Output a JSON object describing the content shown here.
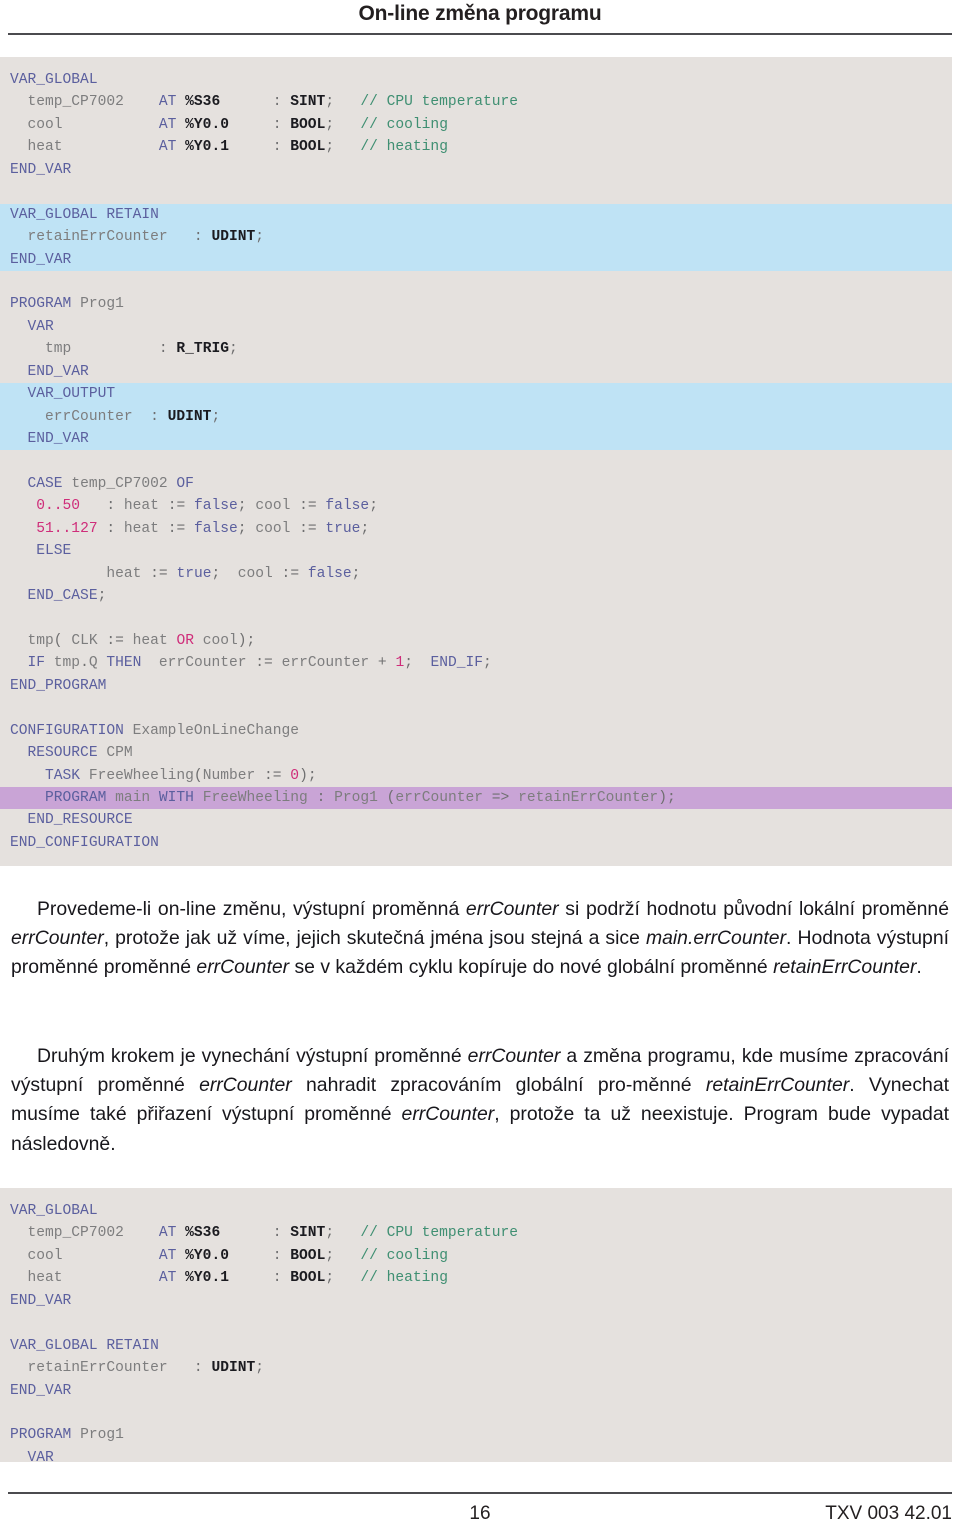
{
  "header": {
    "title": "On-line změna programu"
  },
  "code_block_1": {
    "language": "IEC 61131-3 Structured Text",
    "lines": [
      {
        "highlight": "none",
        "text": "VAR_GLOBAL"
      },
      {
        "highlight": "none",
        "text": "  temp_CP7002    AT %S36      : SINT;   // CPU temperature"
      },
      {
        "highlight": "none",
        "text": "  cool           AT %Y0.0     : BOOL;   // cooling"
      },
      {
        "highlight": "none",
        "text": "  heat           AT %Y0.1     : BOOL;   // heating"
      },
      {
        "highlight": "none",
        "text": "END_VAR"
      },
      {
        "highlight": "none",
        "text": ""
      },
      {
        "highlight": "blue",
        "text": "VAR_GLOBAL RETAIN"
      },
      {
        "highlight": "blue",
        "text": "  retainErrCounter   : UDINT;"
      },
      {
        "highlight": "blue",
        "text": "END_VAR"
      },
      {
        "highlight": "none",
        "text": ""
      },
      {
        "highlight": "none",
        "text": "PROGRAM Prog1"
      },
      {
        "highlight": "none",
        "text": "  VAR"
      },
      {
        "highlight": "none",
        "text": "    tmp          : R_TRIG;"
      },
      {
        "highlight": "none",
        "text": "  END_VAR"
      },
      {
        "highlight": "blue",
        "text": "  VAR_OUTPUT"
      },
      {
        "highlight": "blue",
        "text": "    errCounter  : UDINT;"
      },
      {
        "highlight": "blue",
        "text": "  END_VAR"
      },
      {
        "highlight": "none",
        "text": ""
      },
      {
        "highlight": "none",
        "text": "  CASE temp_CP7002 OF"
      },
      {
        "highlight": "none",
        "text": "   0..50   : heat := false; cool := false;"
      },
      {
        "highlight": "none",
        "text": "   51..127 : heat := false; cool := true;"
      },
      {
        "highlight": "none",
        "text": "   ELSE"
      },
      {
        "highlight": "none",
        "text": "           heat := true;  cool := false;"
      },
      {
        "highlight": "none",
        "text": "  END_CASE;"
      },
      {
        "highlight": "none",
        "text": ""
      },
      {
        "highlight": "none",
        "text": "  tmp( CLK := heat OR cool);"
      },
      {
        "highlight": "none",
        "text": "  IF tmp.Q THEN  errCounter := errCounter + 1;  END_IF;"
      },
      {
        "highlight": "none",
        "text": "END_PROGRAM"
      },
      {
        "highlight": "none",
        "text": ""
      },
      {
        "highlight": "none",
        "text": "CONFIGURATION ExampleOnLineChange"
      },
      {
        "highlight": "none",
        "text": "  RESOURCE CPM"
      },
      {
        "highlight": "none",
        "text": "    TASK FreeWheeling(Number := 0);"
      },
      {
        "highlight": "purple",
        "text": "    PROGRAM main WITH FreeWheeling : Prog1 (errCounter => retainErrCounter);"
      },
      {
        "highlight": "none",
        "text": "  END_RESOURCE"
      },
      {
        "highlight": "none",
        "text": "END_CONFIGURATION"
      }
    ]
  },
  "paragraphs": [
    {
      "id": "paragraph-1",
      "runs": [
        {
          "t": "Provedeme-li on-line změnu, výstupní proměnná ",
          "i": false
        },
        {
          "t": "errCounter",
          "i": true
        },
        {
          "t": " si podrží hodnotu původní lokální proměnné ",
          "i": false
        },
        {
          "t": "errCounter",
          "i": true
        },
        {
          "t": ", protože jak už víme, jejich skutečná jména jsou stejná a sice ",
          "i": false
        },
        {
          "t": "main.errCounter",
          "i": true
        },
        {
          "t": ". Hodnota výstupní proměnné proměnné ",
          "i": false
        },
        {
          "t": "errCounter",
          "i": true
        },
        {
          "t": " se v každém cyklu kopíruje do nové globální proměnné ",
          "i": false
        },
        {
          "t": "retainErrCounter",
          "i": true
        },
        {
          "t": ".",
          "i": false
        }
      ]
    },
    {
      "id": "paragraph-2",
      "runs": [
        {
          "t": "Druhým krokem je vynechání výstupní proměnné ",
          "i": false
        },
        {
          "t": "errCounter",
          "i": true
        },
        {
          "t": " a změna programu, kde musíme zpracování výstupní proměnné ",
          "i": false
        },
        {
          "t": "errCounter",
          "i": true
        },
        {
          "t": " nahradit zpracováním globální pro-měnné ",
          "i": false
        },
        {
          "t": "retainErrCounter",
          "i": true
        },
        {
          "t": ". Vynechat musíme také přiřazení výstupní proměnné ",
          "i": false
        },
        {
          "t": "errCounter",
          "i": true
        },
        {
          "t": ", protože ta už neexistuje. Program bude vypadat následovně.",
          "i": false
        }
      ]
    }
  ],
  "code_block_2": {
    "language": "IEC 61131-3 Structured Text",
    "lines": [
      {
        "highlight": "none",
        "text": "VAR_GLOBAL"
      },
      {
        "highlight": "none",
        "text": "  temp_CP7002    AT %S36      : SINT;   // CPU temperature"
      },
      {
        "highlight": "none",
        "text": "  cool           AT %Y0.0     : BOOL;   // cooling"
      },
      {
        "highlight": "none",
        "text": "  heat           AT %Y0.1     : BOOL;   // heating"
      },
      {
        "highlight": "none",
        "text": "END_VAR"
      },
      {
        "highlight": "none",
        "text": ""
      },
      {
        "highlight": "none",
        "text": "VAR_GLOBAL RETAIN"
      },
      {
        "highlight": "none",
        "text": "  retainErrCounter   : UDINT;"
      },
      {
        "highlight": "none",
        "text": "END_VAR"
      },
      {
        "highlight": "none",
        "text": ""
      },
      {
        "highlight": "none",
        "text": "PROGRAM Prog1"
      },
      {
        "highlight": "none",
        "text": "  VAR"
      }
    ]
  },
  "footer": {
    "page_number": "16",
    "document_code": "TXV 003 42.01"
  },
  "colors": {
    "code_background": "#e5e1de",
    "highlight_blue": "#bfe3f5",
    "highlight_purple": "#c9a4d6",
    "keyword": "#5b5f9e",
    "identifier": "#7d7d7e",
    "type": "#1b1b20",
    "comment": "#3f8f72",
    "number": "#cf2d7a",
    "rule": "#4b4b4f",
    "body_text": "#18171c"
  }
}
